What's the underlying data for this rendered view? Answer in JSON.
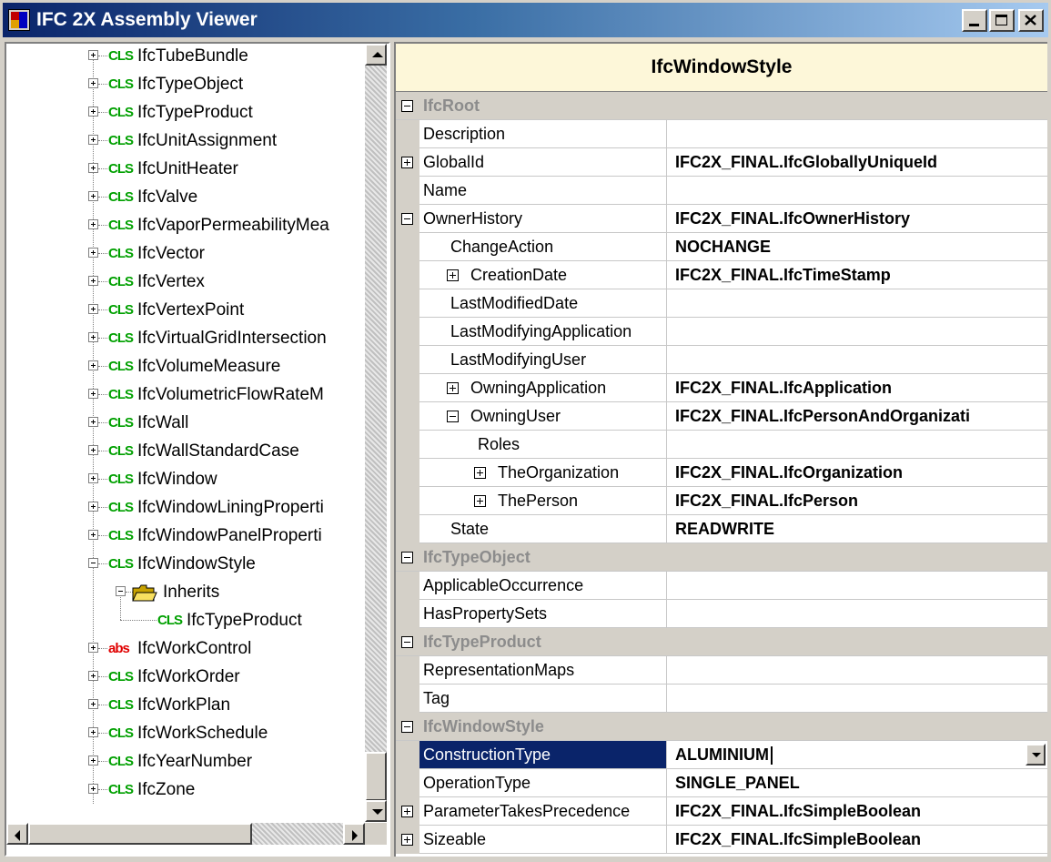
{
  "window": {
    "title": "IFC 2X Assembly Viewer",
    "title_gradient_start": "#0a246a",
    "title_gradient_end": "#a6caf0"
  },
  "title_buttons": [
    "minimize-icon",
    "maximize-icon",
    "close-icon"
  ],
  "tree": {
    "items": [
      {
        "badge": "CLS",
        "label": "IfcTubeBundle"
      },
      {
        "badge": "CLS",
        "label": "IfcTypeObject"
      },
      {
        "badge": "CLS",
        "label": "IfcTypeProduct"
      },
      {
        "badge": "CLS",
        "label": "IfcUnitAssignment"
      },
      {
        "badge": "CLS",
        "label": "IfcUnitHeater"
      },
      {
        "badge": "CLS",
        "label": "IfcValve"
      },
      {
        "badge": "CLS",
        "label": "IfcVaporPermeabilityMea"
      },
      {
        "badge": "CLS",
        "label": "IfcVector"
      },
      {
        "badge": "CLS",
        "label": "IfcVertex"
      },
      {
        "badge": "CLS",
        "label": "IfcVertexPoint"
      },
      {
        "badge": "CLS",
        "label": "IfcVirtualGridIntersection"
      },
      {
        "badge": "CLS",
        "label": "IfcVolumeMeasure"
      },
      {
        "badge": "CLS",
        "label": "IfcVolumetricFlowRateM"
      },
      {
        "badge": "CLS",
        "label": "IfcWall"
      },
      {
        "badge": "CLS",
        "label": "IfcWallStandardCase"
      },
      {
        "badge": "CLS",
        "label": "IfcWindow"
      },
      {
        "badge": "CLS",
        "label": "IfcWindowLiningProperti"
      },
      {
        "badge": "CLS",
        "label": "IfcWindowPanelProperti"
      },
      {
        "badge": "CLS",
        "label": "IfcWindowStyle",
        "expanded": true
      },
      {
        "badge": "folder",
        "label": "Inherits",
        "expanded": true
      },
      {
        "badge": "CLS",
        "label": "IfcTypeProduct",
        "leaf": true
      },
      {
        "badge": "abs",
        "label": "IfcWorkControl"
      },
      {
        "badge": "CLS",
        "label": "IfcWorkOrder"
      },
      {
        "badge": "CLS",
        "label": "IfcWorkPlan"
      },
      {
        "badge": "CLS",
        "label": "IfcWorkSchedule"
      },
      {
        "badge": "CLS",
        "label": "IfcYearNumber"
      },
      {
        "badge": "CLS",
        "label": "IfcZone"
      }
    ],
    "cls_color": "#00a000",
    "abs_color": "#e00000"
  },
  "properties": {
    "title": "IfcWindowStyle",
    "header_bg": "#fdf7d9",
    "rows": [
      {
        "kind": "category",
        "name": "IfcRoot",
        "expander": "minus"
      },
      {
        "kind": "prop",
        "name": "Description",
        "value": ""
      },
      {
        "kind": "prop",
        "name": "GlobalId",
        "value": "IFC2X_FINAL.IfcGloballyUniqueId",
        "expander": "plus"
      },
      {
        "kind": "prop",
        "name": "Name",
        "value": ""
      },
      {
        "kind": "prop",
        "name": "OwnerHistory",
        "value": "IFC2X_FINAL.IfcOwnerHistory",
        "expander": "minus"
      },
      {
        "kind": "prop",
        "name": "ChangeAction",
        "value": "NOCHANGE",
        "indent": 1
      },
      {
        "kind": "prop",
        "name": "CreationDate",
        "value": "IFC2X_FINAL.IfcTimeStamp",
        "indent": 1,
        "expander": "plus"
      },
      {
        "kind": "prop",
        "name": "LastModifiedDate",
        "value": "",
        "indent": 1
      },
      {
        "kind": "prop",
        "name": "LastModifyingApplication",
        "value": "",
        "indent": 1
      },
      {
        "kind": "prop",
        "name": "LastModifyingUser",
        "value": "",
        "indent": 1
      },
      {
        "kind": "prop",
        "name": "OwningApplication",
        "value": "IFC2X_FINAL.IfcApplication",
        "indent": 1,
        "expander": "plus"
      },
      {
        "kind": "prop",
        "name": "OwningUser",
        "value": "IFC2X_FINAL.IfcPersonAndOrganizati",
        "indent": 1,
        "expander": "minus"
      },
      {
        "kind": "prop",
        "name": "Roles",
        "value": "",
        "indent": 2
      },
      {
        "kind": "prop",
        "name": "TheOrganization",
        "value": "IFC2X_FINAL.IfcOrganization",
        "indent": 2,
        "expander": "plus"
      },
      {
        "kind": "prop",
        "name": "ThePerson",
        "value": "IFC2X_FINAL.IfcPerson",
        "indent": 2,
        "expander": "plus"
      },
      {
        "kind": "prop",
        "name": "State",
        "value": "READWRITE",
        "indent": 1
      },
      {
        "kind": "category",
        "name": "IfcTypeObject",
        "expander": "minus"
      },
      {
        "kind": "prop",
        "name": "ApplicableOccurrence",
        "value": ""
      },
      {
        "kind": "prop",
        "name": "HasPropertySets",
        "value": ""
      },
      {
        "kind": "category",
        "name": "IfcTypeProduct",
        "expander": "minus"
      },
      {
        "kind": "prop",
        "name": "RepresentationMaps",
        "value": ""
      },
      {
        "kind": "prop",
        "name": "Tag",
        "value": ""
      },
      {
        "kind": "category",
        "name": "IfcWindowStyle",
        "expander": "minus"
      },
      {
        "kind": "prop",
        "name": "ConstructionType",
        "value": "ALUMINIUM",
        "selected": true,
        "dropdown": true
      },
      {
        "kind": "prop",
        "name": "OperationType",
        "value": "SINGLE_PANEL"
      },
      {
        "kind": "prop",
        "name": "ParameterTakesPrecedence",
        "value": "IFC2X_FINAL.IfcSimpleBoolean",
        "expander": "plus"
      },
      {
        "kind": "prop",
        "name": "Sizeable",
        "value": "IFC2X_FINAL.IfcSimpleBoolean",
        "expander": "plus"
      }
    ],
    "selection_color": "#0a246a"
  }
}
